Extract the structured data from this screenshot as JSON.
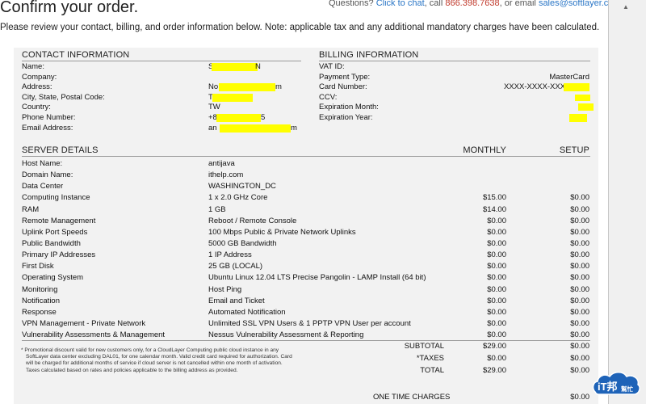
{
  "header": {
    "title": "Confirm your order.",
    "questions_prefix": "Questions?",
    "chat_link": "Click to chat",
    "call_text": ", call",
    "phone": "866.398.7638",
    "email_text": ", or email",
    "email": "sales@softlayer.com",
    "intro": "Please review your contact, billing, and order information below. Note: applicable tax and any additional mandatory charges have been calculated."
  },
  "contact": {
    "heading": "CONTACT INFORMATION",
    "rows": [
      {
        "label": "Name:",
        "value": "S",
        "tail": "N"
      },
      {
        "label": "Company:",
        "value": "",
        "tail": ""
      },
      {
        "label": "Address:",
        "value": "No",
        "tail": "m"
      },
      {
        "label": "City, State, Postal Code:",
        "value": "T",
        "tail": ""
      },
      {
        "label": "Country:",
        "value": "TW",
        "tail": ""
      },
      {
        "label": "Phone Number:",
        "value": "+8",
        "tail": "5"
      },
      {
        "label": "Email Address:",
        "value": "an",
        "tail": "m"
      }
    ]
  },
  "billing": {
    "heading": "BILLING INFORMATION",
    "rows": [
      {
        "label": "VAT ID:",
        "value": ""
      },
      {
        "label": "Payment Type:",
        "value": "MasterCard"
      },
      {
        "label": "Card Number:",
        "value": "XXXX-XXXX-XXX"
      },
      {
        "label": "CCV:",
        "value": ""
      },
      {
        "label": "Expiration Month:",
        "value": ""
      },
      {
        "label": "Expiration Year:",
        "value": ""
      }
    ]
  },
  "server": {
    "heading": "SERVER DETAILS",
    "monthly_header": "MONTHLY",
    "setup_header": "SETUP",
    "rows": [
      {
        "label": "Host Name:",
        "value": "antijava",
        "monthly": "",
        "setup": ""
      },
      {
        "label": "Domain Name:",
        "value": "ithelp.com",
        "monthly": "",
        "setup": ""
      },
      {
        "label": "Data Center",
        "value": "WASHINGTON_DC",
        "monthly": "",
        "setup": ""
      },
      {
        "label": "Computing Instance",
        "value": "1 x 2.0 GHz Core",
        "monthly": "$15.00",
        "setup": "$0.00"
      },
      {
        "label": "RAM",
        "value": "1 GB",
        "monthly": "$14.00",
        "setup": "$0.00"
      },
      {
        "label": "Remote Management",
        "value": "Reboot / Remote Console",
        "monthly": "$0.00",
        "setup": "$0.00"
      },
      {
        "label": "Uplink Port Speeds",
        "value": "100 Mbps Public & Private Network Uplinks",
        "monthly": "$0.00",
        "setup": "$0.00"
      },
      {
        "label": "Public Bandwidth",
        "value": "5000 GB Bandwidth",
        "monthly": "$0.00",
        "setup": "$0.00"
      },
      {
        "label": "Primary IP Addresses",
        "value": "1 IP Address",
        "monthly": "$0.00",
        "setup": "$0.00"
      },
      {
        "label": "First Disk",
        "value": "25 GB (LOCAL)",
        "monthly": "$0.00",
        "setup": "$0.00"
      },
      {
        "label": "Operating System",
        "value": "Ubuntu Linux 12.04 LTS Precise Pangolin - LAMP Install (64 bit)",
        "monthly": "$0.00",
        "setup": "$0.00"
      },
      {
        "label": "Monitoring",
        "value": "Host Ping",
        "monthly": "$0.00",
        "setup": "$0.00"
      },
      {
        "label": "Notification",
        "value": "Email and Ticket",
        "monthly": "$0.00",
        "setup": "$0.00"
      },
      {
        "label": "Response",
        "value": "Automated Notification",
        "monthly": "$0.00",
        "setup": "$0.00"
      },
      {
        "label": "VPN Management - Private Network",
        "value": "Unlimited SSL VPN Users & 1 PPTP VPN User per account",
        "monthly": "$0.00",
        "setup": "$0.00"
      },
      {
        "label": "Vulnerability Assessments & Management",
        "value": "Nessus Vulnerability Assessment & Reporting",
        "monthly": "$0.00",
        "setup": "$0.00"
      }
    ]
  },
  "totals": [
    {
      "label": "SUBTOTAL",
      "monthly": "$29.00",
      "setup": "$0.00"
    },
    {
      "label": "*TAXES",
      "monthly": "$0.00",
      "setup": "$0.00"
    },
    {
      "label": "TOTAL",
      "monthly": "$29.00",
      "setup": "$0.00"
    }
  ],
  "one_time": {
    "label": "ONE TIME CHARGES",
    "value": "$0.00"
  },
  "footnote": [
    "* Promotional discount valid for new customers only, for a CloudLayer Computing public cloud instance in any",
    "SoftLayer data center excluding DAL01, for one calendar month. Valid credit card required for authorization. Card",
    "will be charged for additional months of service if cloud server is not cancelled within one month of activation.",
    "Taxes calculated based on rates and policies applicable to the billing address as provided."
  ],
  "badge": {
    "text": "iT邦",
    "subtext": "幫忙"
  },
  "colors": {
    "link": "#2a76c6",
    "phone": "#c0392b",
    "redaction": "#ffff00",
    "panel": "#f2f2f2"
  }
}
